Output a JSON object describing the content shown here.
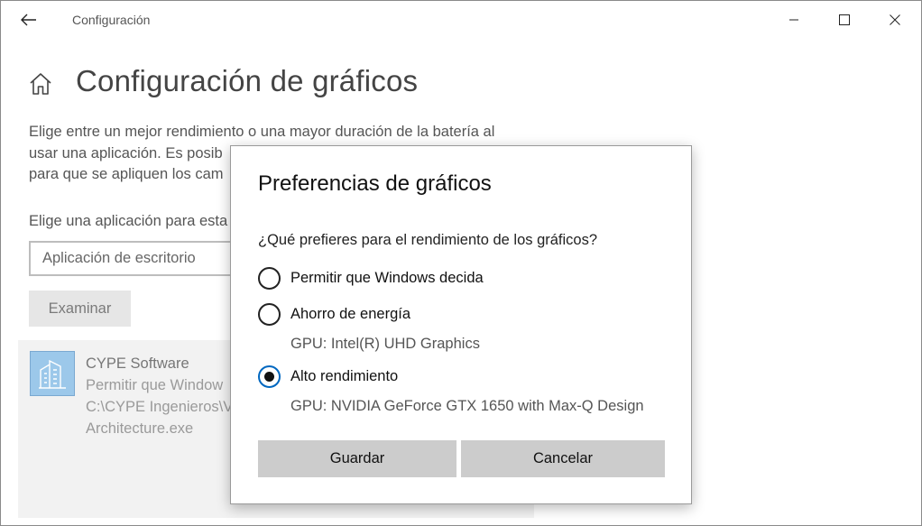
{
  "window": {
    "title": "Configuración",
    "controls": [
      "minimize-icon",
      "maximize-icon",
      "close-icon"
    ]
  },
  "page": {
    "title": "Configuración de gráficos",
    "description_lines": [
      "Elige entre un mejor rendimiento o una mayor duración de la batería al",
      "usar una aplicación. Es posib",
      "para que se apliquen los cam"
    ],
    "choose_label": "Elige una aplicación para esta",
    "app_type_value": "Aplicación de escritorio",
    "browse_button": "Examinar"
  },
  "app_card": {
    "name": "CYPE Software",
    "lines": [
      "Permitir que Window",
      "C:\\CYPE Ingenieros\\V",
      "Architecture.exe"
    ]
  },
  "dialog": {
    "title": "Preferencias de gráficos",
    "question": "¿Qué prefieres para el rendimiento de los gráficos?",
    "options": [
      {
        "label": "Permitir que Windows decida",
        "gpu": "",
        "selected": false
      },
      {
        "label": "Ahorro de energía",
        "gpu": "GPU: Intel(R) UHD Graphics",
        "selected": false
      },
      {
        "label": "Alto rendimiento",
        "gpu": "GPU: NVIDIA GeForce GTX 1650 with Max-Q Design",
        "selected": true
      }
    ],
    "save_button": "Guardar",
    "cancel_button": "Cancelar"
  },
  "colors": {
    "accent": "#0067c0",
    "button_bg": "#cccccc",
    "card_bg": "#f2f2f2"
  }
}
